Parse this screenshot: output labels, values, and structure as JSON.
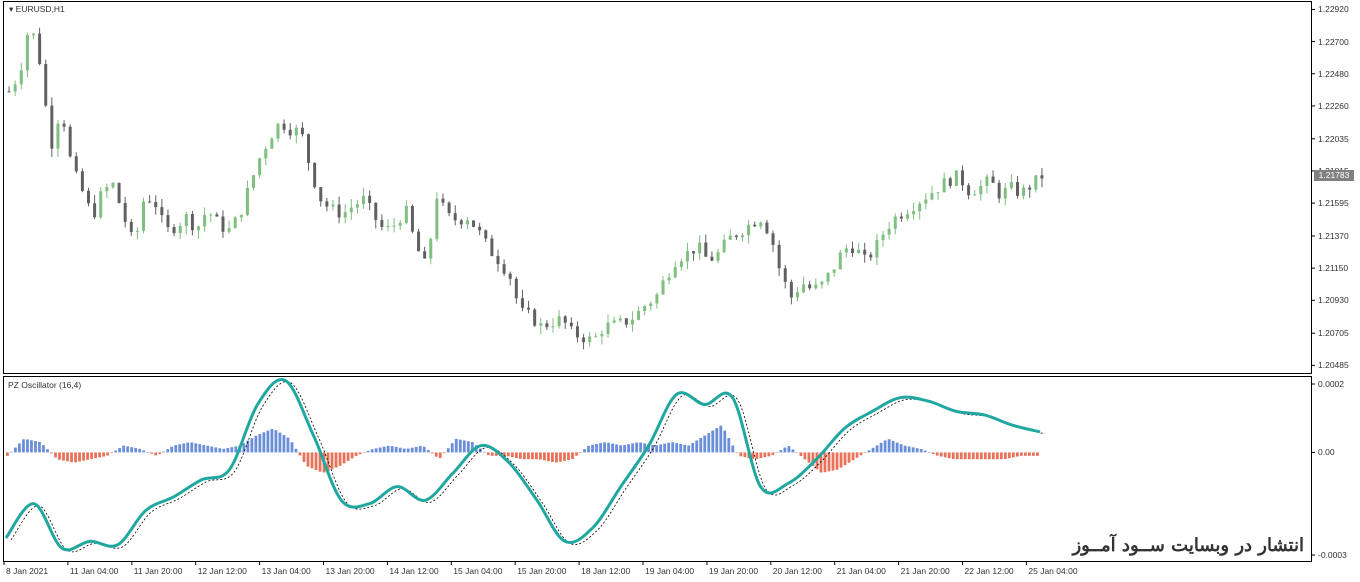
{
  "main_chart": {
    "label": "EURUSD,H1",
    "current_price": "1.21783",
    "price_ticks": [
      "1.22920",
      "1.22700",
      "1.22480",
      "1.22260",
      "1.22035",
      "1.21815",
      "1.21595",
      "1.21370",
      "1.21150",
      "1.20930",
      "1.20705",
      "1.20485"
    ]
  },
  "oscillator": {
    "label": "PZ Oscillator (16,4)",
    "ticks": [
      "0.0002",
      "0.00",
      "-0.0003"
    ]
  },
  "time_axis": [
    "8 Jan 2021",
    "11 Jan 04:00",
    "11 Jan 20:00",
    "12 Jan 12:00",
    "13 Jan 04:00",
    "13 Jan 20:00",
    "14 Jan 12:00",
    "15 Jan 04:00",
    "15 Jan 20:00",
    "18 Jan 12:00",
    "19 Jan 04:00",
    "19 Jan 20:00",
    "20 Jan 12:00",
    "21 Jan 04:00",
    "21 Jan 20:00",
    "22 Jan 12:00",
    "25 Jan 04:00"
  ],
  "watermark": "انتشار در وبسایت ســود آمــوز",
  "colors": {
    "bull_candle": "#7fbf7f",
    "bear_candle": "#606060",
    "hist_positive": "#6a8fd8",
    "hist_negative": "#e8735a",
    "osc_line": "#20a8a0",
    "signal_line": "#000000"
  },
  "chart_data": {
    "type": "candlestick+histogram",
    "symbol": "EURUSD,H1",
    "price_ylim": [
      1.2046,
      1.2293
    ],
    "price_path": [
      1.2236,
      1.2248,
      1.2284,
      1.2255,
      1.2198,
      1.2226,
      1.2184,
      1.2168,
      1.215,
      1.2168,
      1.2172,
      1.215,
      1.213,
      1.2165,
      1.216,
      1.214,
      1.2144,
      1.215,
      1.2142,
      1.2155,
      1.2146,
      1.214,
      1.215,
      1.217,
      1.219,
      1.2205,
      1.2215,
      1.221,
      1.2208,
      1.218,
      1.216,
      1.2155,
      1.2152,
      1.2158,
      1.2162,
      1.215,
      1.214,
      1.2145,
      1.2155,
      1.213,
      1.2115,
      1.2165,
      1.215,
      1.2148,
      1.215,
      1.214,
      1.2128,
      1.212,
      1.211,
      1.2085,
      1.2082,
      1.2075,
      1.2078,
      1.208,
      1.207,
      1.2068,
      1.2065,
      1.2075,
      1.2076,
      1.2078,
      1.2082,
      1.209,
      1.2095,
      1.211,
      1.2122,
      1.2125,
      1.213,
      1.212,
      1.2125,
      1.2135,
      1.214,
      1.2145,
      1.215,
      1.2138,
      1.211,
      1.2095,
      1.2105,
      1.21,
      1.2104,
      1.2115,
      1.2128,
      1.213,
      1.212,
      1.2128,
      1.2142,
      1.215,
      1.2155,
      1.216,
      1.2165,
      1.217,
      1.2175,
      1.2178,
      1.2168,
      1.217,
      1.2175,
      1.2165,
      1.217,
      1.2166,
      1.2172,
      1.2178
    ],
    "osc_ylim": [
      -0.0003,
      0.0002
    ],
    "histogram": [
      -1e-05,
      4e-05,
      3e-05,
      -2e-05,
      -3e-05,
      -2e-05,
      -1e-05,
      2e-05,
      1e-05,
      -1e-05,
      2e-05,
      3e-05,
      2e-05,
      1e-05,
      2e-05,
      5e-05,
      7e-05,
      4e-05,
      -4e-05,
      -6e-05,
      -4e-05,
      -1e-05,
      1e-05,
      2e-05,
      1e-05,
      2e-05,
      -2e-05,
      4e-05,
      3e-05,
      -1e-05,
      -1e-05,
      -2e-05,
      -2e-05,
      -3e-05,
      -2e-05,
      2e-05,
      3e-05,
      2e-05,
      3e-05,
      2e-05,
      3e-05,
      2e-05,
      5e-05,
      8e-05,
      -1e-05,
      -2e-05,
      -1e-05,
      2e-05,
      -2e-05,
      -6e-05,
      -5e-05,
      -2e-05,
      1e-05,
      4e-05,
      2e-05,
      1e-05,
      -1e-05,
      -2e-05,
      -2e-05,
      -2e-05,
      -2e-05,
      -1e-05,
      -1e-05
    ],
    "osc_line": [
      -0.00025,
      -0.00015,
      -0.00028,
      -0.00026,
      -0.00027,
      -0.00017,
      -0.00013,
      -8e-05,
      -5e-05,
      0.00014,
      0.00021,
      5e-05,
      -0.00014,
      -0.00015,
      -0.0001,
      -0.00014,
      -6e-05,
      2e-05,
      -3e-05,
      -0.00014,
      -0.00026,
      -0.00022,
      -0.0001,
      2e-05,
      0.00017,
      0.00014,
      0.00016,
      -0.0001,
      -9e-05,
      -2e-05,
      7e-05,
      0.00012,
      0.00016,
      0.00015,
      0.00012,
      0.00011,
      8e-05,
      6e-05
    ]
  }
}
